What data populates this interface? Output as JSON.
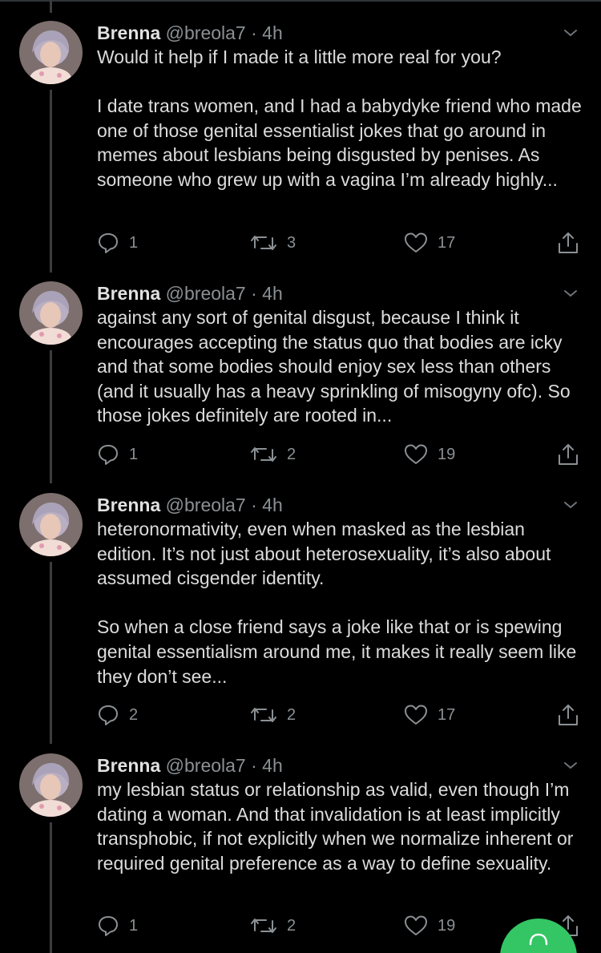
{
  "tweets": [
    {
      "name": "Brenna",
      "handle": "@breola7",
      "dot": "·",
      "time": "4h",
      "paragraphs": [
        "Would it help if I made it a little more real for you?",
        "I date trans women, and I had a babydyke friend who made one of those genital essentialist jokes that go around in memes about lesbians being disgusted by penises. As someone who grew up with a vagina I’m already highly..."
      ],
      "replies": "1",
      "retweets": "3",
      "likes": "17"
    },
    {
      "name": "Brenna",
      "handle": "@breola7",
      "dot": "·",
      "time": "4h",
      "paragraphs": [
        "against any sort of genital disgust, because I think it encourages accepting the status quo that bodies are icky and that some bodies should enjoy sex less than others (and it usually has a heavy sprinkling of misogyny ofc). So those jokes definitely are rooted in..."
      ],
      "replies": "1",
      "retweets": "2",
      "likes": "19"
    },
    {
      "name": "Brenna",
      "handle": "@breola7",
      "dot": "·",
      "time": "4h",
      "paragraphs": [
        "heteronormativity, even when masked as the lesbian edition. It’s not just about heterosexuality, it’s also about assumed cisgender identity.",
        "So when a close friend says a joke like that or is spewing genital essentialism around me, it makes it really seem like they don’t see..."
      ],
      "replies": "2",
      "retweets": "2",
      "likes": "17"
    },
    {
      "name": "Brenna",
      "handle": "@breola7",
      "dot": "·",
      "time": "4h",
      "paragraphs": [
        "my lesbian status or relationship as valid, even though I’m dating a woman. And that invalidation is at least implicitly transphobic, if not explicitly when we normalize inherent or required genital preference as a way to define sexuality."
      ],
      "replies": "1",
      "retweets": "2",
      "likes": "19"
    }
  ],
  "icons": {
    "reply": "reply-icon",
    "retweet": "retweet-icon",
    "like": "heart-icon",
    "share": "share-icon",
    "menu": "chevron-down-icon",
    "compose": "compose-icon"
  },
  "colors": {
    "background": "#000000",
    "text": "#dcdcdc",
    "muted": "#8b9094",
    "thread_line": "#3a3d40",
    "fab": "#34c565"
  }
}
